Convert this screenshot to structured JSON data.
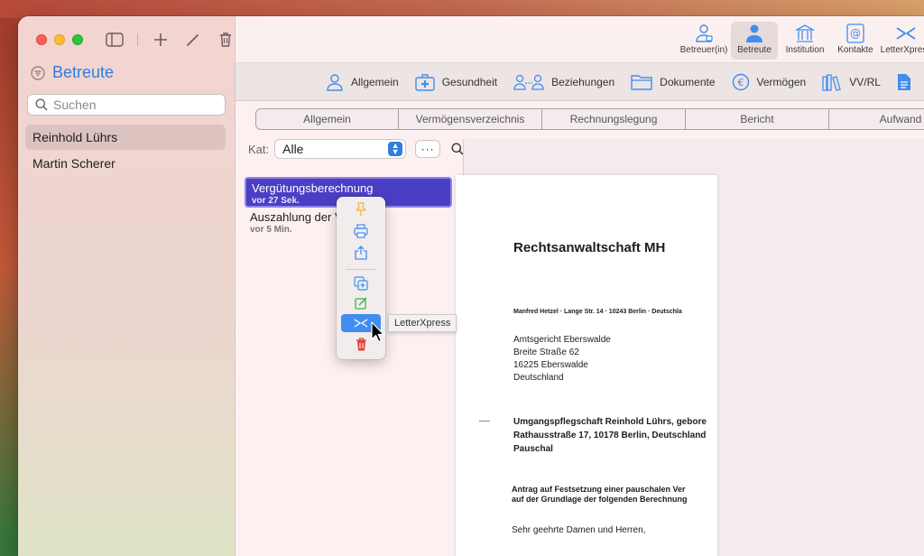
{
  "sidebar": {
    "title": "Betreute",
    "search_placeholder": "Suchen",
    "items": [
      {
        "label": "Reinhold Lührs",
        "selected": true
      },
      {
        "label": "Martin Scherer",
        "selected": false
      }
    ]
  },
  "toolbar": {
    "icons": [
      {
        "label": "Betreuer(in)",
        "icon": "person-badge-icon"
      },
      {
        "label": "Betreute",
        "icon": "person-icon",
        "active": true
      },
      {
        "label": "Institution",
        "icon": "building-columns-icon"
      },
      {
        "label": "Kontakte",
        "icon": "at-contact-icon"
      },
      {
        "label": "LetterXpress",
        "icon": "letterxpress-icon"
      }
    ]
  },
  "nav": {
    "items": [
      {
        "label": "Allgemein",
        "icon": "person-icon"
      },
      {
        "label": "Gesundheit",
        "icon": "medical-kit-icon"
      },
      {
        "label": "Beziehungen",
        "icon": "relations-icon"
      },
      {
        "label": "Dokumente",
        "icon": "folder-icon"
      },
      {
        "label": "Vermögen",
        "icon": "euro-icon"
      },
      {
        "label": "VV/RL",
        "icon": "books-icon"
      }
    ]
  },
  "segments": [
    "Allgemein",
    "Vermögensverzeichnis",
    "Rechnungslegung",
    "Bericht",
    "Aufwand"
  ],
  "filter": {
    "label": "Kat:",
    "value": "Alle",
    "more": "···"
  },
  "documents": [
    {
      "title": "Vergütungsberechnung",
      "time": "vor 27 Sek.",
      "selected": true
    },
    {
      "title": "Auszahlung der Ve",
      "time": "vor 5 Min.",
      "selected": false
    }
  ],
  "context_menu": {
    "tooltip": "LetterXpress",
    "colors": {
      "pin": "#f3b733",
      "print": "#3f8ef0",
      "share": "#3f8ef0",
      "duplicate": "#3f8ef0",
      "edit": "#3bb34a",
      "trash": "#e0453a"
    }
  },
  "letter": {
    "firm": "Rechtsanwaltschaft MH",
    "sender": "Manfred Hetzel · Lange Str. 14 · 10243 Berlin · Deutschla",
    "address": [
      "Amtsgericht Eberswalde",
      "Breite Straße 62",
      "16225 Eberswalde",
      "Deutschland"
    ],
    "subject": [
      "Umgangspflegschaft Reinhold Lührs, gebore",
      "Rathausstraße 17, 10178 Berlin, Deutschland",
      "Pauschal"
    ],
    "antrag": [
      "Antrag auf Festsetzung einer pauschalen Ver",
      "auf der Grundlage der folgenden Berechnung"
    ],
    "greeting": "Sehr geehrte Damen und Herren,"
  }
}
